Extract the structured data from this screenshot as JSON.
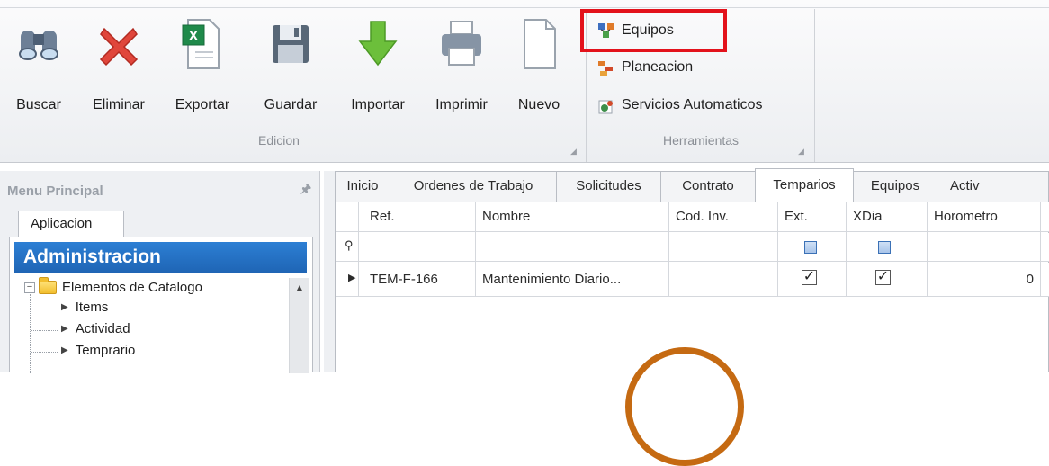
{
  "ribbon": {
    "buttons": {
      "buscar": "Buscar",
      "eliminar": "Eliminar",
      "exportar": "Exportar",
      "guardar": "Guardar",
      "importar": "Importar",
      "imprimir": "Imprimir",
      "nuevo": "Nuevo"
    },
    "group_edicion": "Edicion",
    "tools": {
      "equipos": "Equipos",
      "planeacion": "Planeacion",
      "servicios": "Servicios Automaticos"
    },
    "group_herramientas": "Herramientas"
  },
  "menu": {
    "title": "Menu Principal",
    "tab": "Aplicacion",
    "section": "Administracion",
    "tree": {
      "root": "Elementos de Catalogo",
      "children": [
        "Items",
        "Actividad",
        "Temprario"
      ]
    }
  },
  "tabs": [
    "Inicio",
    "Ordenes de Trabajo",
    "Solicitudes",
    "Contrato",
    "Temparios",
    "Equipos",
    "Activ"
  ],
  "active_tab": "Temparios",
  "grid": {
    "columns": [
      "Ref.",
      "Nombre",
      "Cod. Inv.",
      "Ext.",
      "XDia",
      "Horometro"
    ],
    "rows": [
      {
        "ref": "TEM-F-166",
        "nombre": "Mantenimiento Diario...",
        "cod_inv": "",
        "ext": true,
        "xdia": true,
        "horometro": "0"
      }
    ]
  },
  "colors": {
    "highlight": "#e3121b",
    "section_header": "#2173c4",
    "annotation_circle": "#c56a12"
  }
}
